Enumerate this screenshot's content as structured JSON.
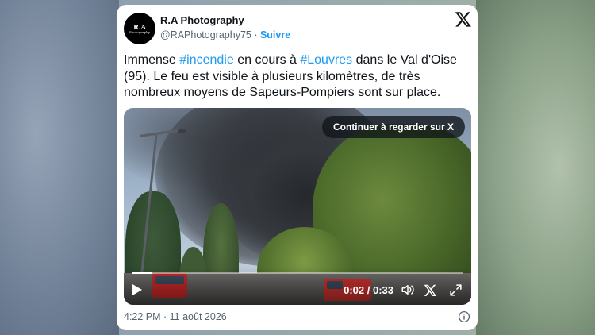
{
  "tweet": {
    "author_name": "R.A Photography",
    "avatar_text_line1": "R.A",
    "avatar_text_line2": "Photography",
    "handle": "@RAPhotography75",
    "separator": " · ",
    "follow_label": "Suivre",
    "text_parts": {
      "t1": "Immense ",
      "tag1": "#incendie",
      "t2": " en cours à ",
      "tag2": "#Louvres",
      "t3": " dans le Val d'Oise (95). Le feu est visible à plusieurs kilomètres, de très nombreux moyens de Sapeurs-Pompiers sont sur place."
    },
    "timestamp": "4:22 PM · 11 août 2026"
  },
  "video": {
    "continue_label": "Continuer à regarder sur X",
    "time_display": "0:02 / 0:33",
    "elapsed_seconds": 2,
    "duration_seconds": 33
  },
  "icons": {
    "header_logo": "x-logo-icon",
    "play": "play-icon",
    "volume": "volume-icon",
    "video_logo": "x-logo-icon",
    "fullscreen": "fullscreen-icon",
    "info": "info-icon"
  },
  "colors": {
    "link": "#1d9bf0",
    "text": "#0f1419",
    "secondary": "#536471"
  }
}
